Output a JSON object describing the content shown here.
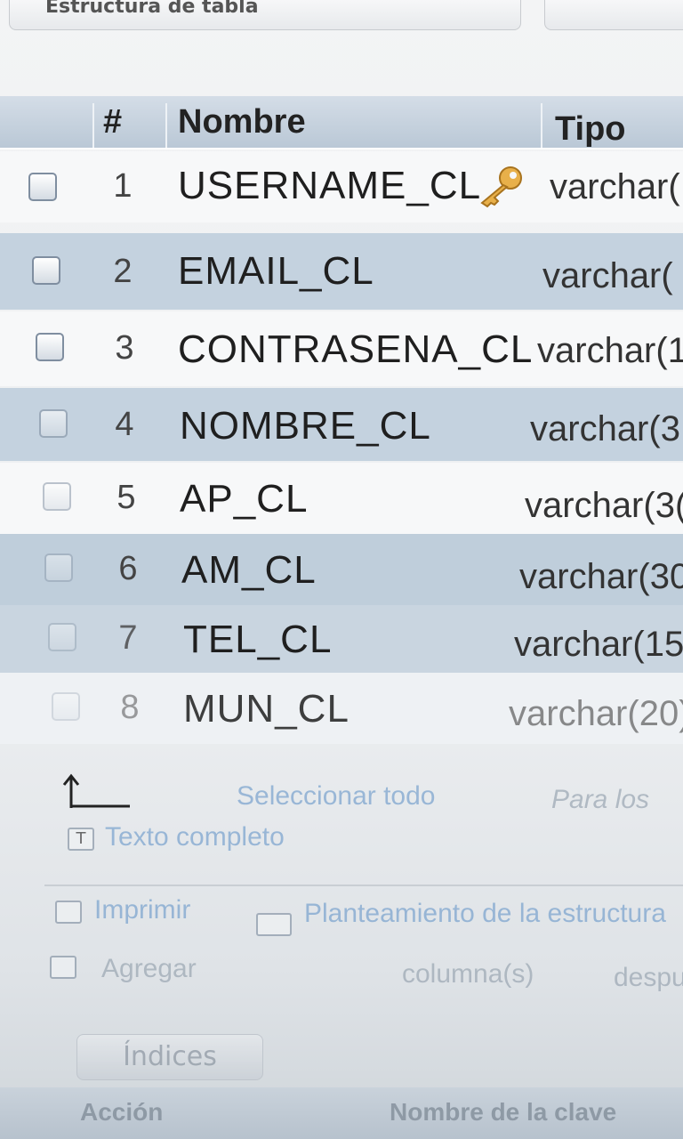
{
  "top_tabs": [
    {
      "label": "Estructura de tabla"
    },
    {
      "label": ""
    }
  ],
  "table": {
    "headers": [
      "#",
      "Nombre",
      "Tipo"
    ],
    "rows": [
      {
        "num": "1",
        "name": "USERNAME_CL",
        "type": "varchar(",
        "primary_key": true
      },
      {
        "num": "2",
        "name": "EMAIL_CL",
        "type": "varchar("
      },
      {
        "num": "3",
        "name": "CONTRASENA_CL",
        "type": "varchar(1"
      },
      {
        "num": "4",
        "name": "NOMBRE_CL",
        "type": "varchar(3"
      },
      {
        "num": "5",
        "name": "AP_CL",
        "type": "varchar(3("
      },
      {
        "num": "6",
        "name": "AM_CL",
        "type": "varchar(30"
      },
      {
        "num": "7",
        "name": "TEL_CL",
        "type": "varchar(15"
      },
      {
        "num": "8",
        "name": "MUN_CL",
        "type": "varchar(20)"
      }
    ]
  },
  "controls": {
    "select_all": "Seleccionar todo",
    "for_selected": "Para los",
    "full_text": "Texto completo",
    "print": "Imprimir",
    "structure_plan": "Planteamiento de la estructura",
    "add": "Agregar",
    "columns": "columna(s)",
    "after": "después",
    "indexes_button": "Índices"
  },
  "footer": {
    "action": "Acción",
    "key_name": "Nombre de la clave"
  },
  "colors": {
    "header_bg": "#c4d2df",
    "row_alt": "#c4d2df",
    "link": "#7fa6cf",
    "key_icon": "#e8b04a"
  }
}
